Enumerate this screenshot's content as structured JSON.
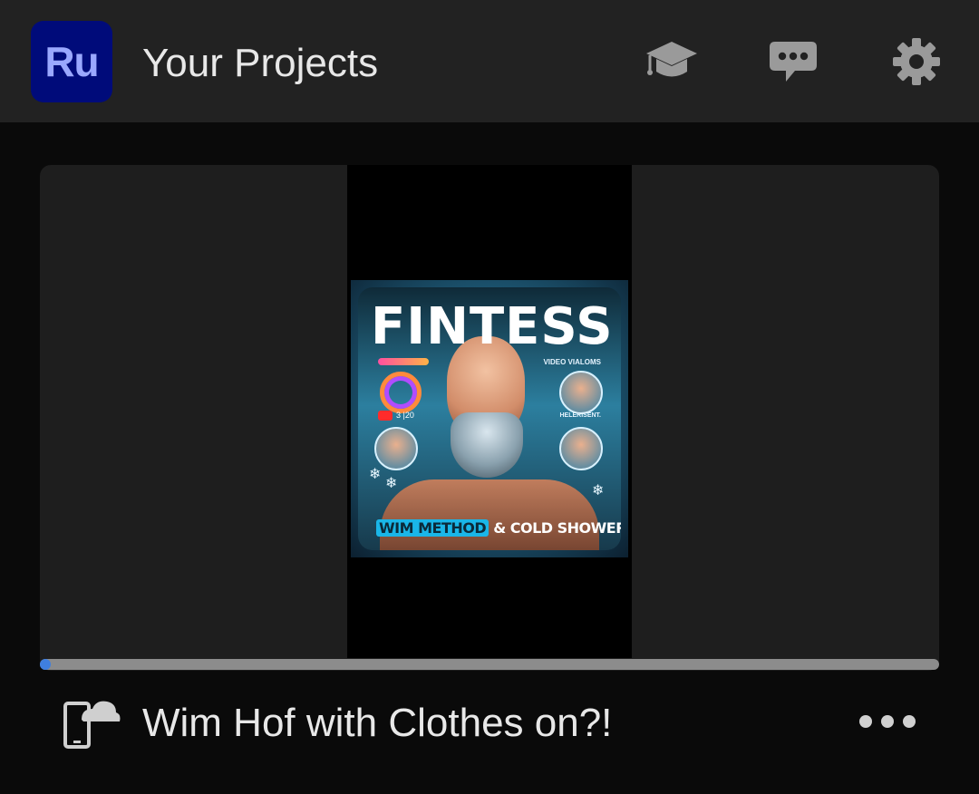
{
  "header": {
    "app_logo_text": "Ru",
    "title": "Your Projects",
    "icons": [
      "graduation-cap-icon",
      "speech-bubble-icon",
      "gear-icon"
    ]
  },
  "project": {
    "name": "Wim Hof with Clothes on?!",
    "status_icon": "device-cloud-icon",
    "progress": 0.01,
    "thumbnail": {
      "title": "FINTESS",
      "subtitle": "VIDEO VIALOMS",
      "counter": "3 |20",
      "side_label": "HELERISENT.",
      "caption_highlight": "WIM METHOD",
      "caption_rest": "& COLD SHOWER"
    }
  },
  "colors": {
    "header_bg": "#222222",
    "page_bg": "#0a0a0a",
    "card_bg": "#1e1e1e",
    "logo_bg": "#000b7a",
    "logo_text": "#9aa8ff",
    "progress_fill": "#3f7fe0",
    "progress_track": "#8c8c8c"
  }
}
